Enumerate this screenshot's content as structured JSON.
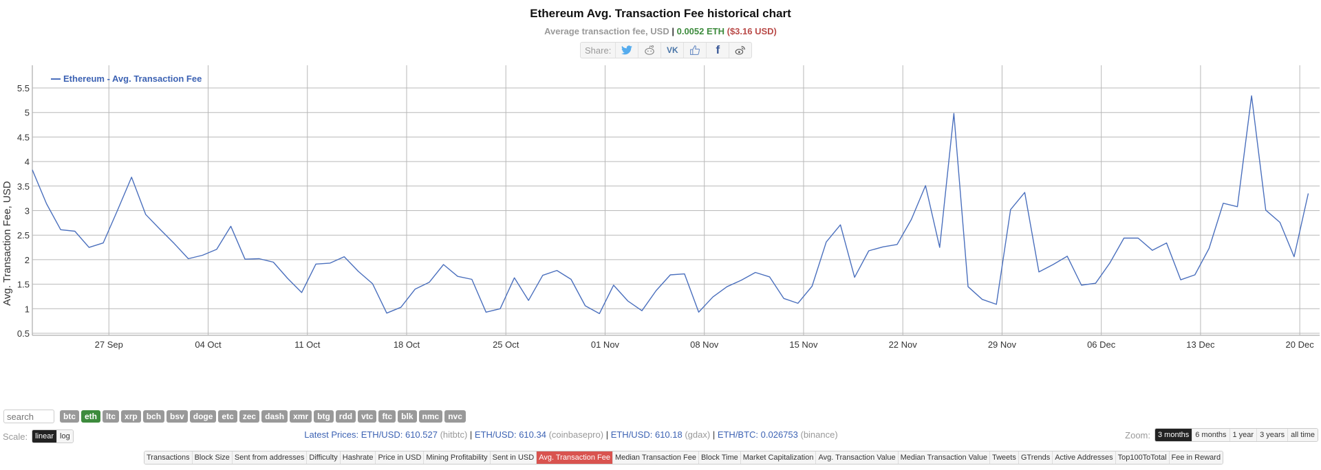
{
  "header": {
    "title": "Ethereum Avg. Transaction Fee historical chart",
    "subtitle_label": "Average transaction fee, USD",
    "subtitle_sep": "|",
    "subtitle_eth": "0.0052 ETH",
    "subtitle_usd": "($3.16 USD)"
  },
  "share": {
    "label": "Share:",
    "icons": [
      {
        "name": "twitter-icon",
        "glyph": "🐦"
      },
      {
        "name": "reddit-icon",
        "glyph": "☺"
      },
      {
        "name": "vk-icon",
        "glyph": "VK"
      },
      {
        "name": "like-icon",
        "glyph": "👍"
      },
      {
        "name": "facebook-icon",
        "glyph": "f"
      },
      {
        "name": "weibo-icon",
        "glyph": "ஃ"
      }
    ]
  },
  "colors": {
    "line": "#4a6fbd",
    "grid": "#b8b8b8",
    "eth_green": "#3d8b3d",
    "usd_red": "#b94a48",
    "active_tab": "#d9534f"
  },
  "search": {
    "placeholder": "search"
  },
  "coins": [
    {
      "label": "btc",
      "active": false
    },
    {
      "label": "eth",
      "active": true
    },
    {
      "label": "ltc",
      "active": false
    },
    {
      "label": "xrp",
      "active": false
    },
    {
      "label": "bch",
      "active": false
    },
    {
      "label": "bsv",
      "active": false
    },
    {
      "label": "doge",
      "active": false
    },
    {
      "label": "etc",
      "active": false
    },
    {
      "label": "zec",
      "active": false
    },
    {
      "label": "dash",
      "active": false
    },
    {
      "label": "xmr",
      "active": false
    },
    {
      "label": "btg",
      "active": false
    },
    {
      "label": "rdd",
      "active": false
    },
    {
      "label": "vtc",
      "active": false
    },
    {
      "label": "ftc",
      "active": false
    },
    {
      "label": "blk",
      "active": false
    },
    {
      "label": "nmc",
      "active": false
    },
    {
      "label": "nvc",
      "active": false
    }
  ],
  "scale": {
    "label": "Scale:",
    "options": [
      {
        "label": "linear",
        "active": true
      },
      {
        "label": "log",
        "active": false
      }
    ]
  },
  "prices": {
    "prefix": "Latest Prices:",
    "items": [
      {
        "pair": "ETH/USD: 610.527",
        "source": "(hitbtc)"
      },
      {
        "pair": "ETH/USD: 610.34",
        "source": "(coinbasepro)"
      },
      {
        "pair": "ETH/USD: 610.18",
        "source": "(gdax)"
      },
      {
        "pair": "ETH/BTC: 0.026753",
        "source": "(binance)"
      }
    ]
  },
  "zoom": {
    "label": "Zoom:",
    "options": [
      {
        "label": "3 months",
        "active": true
      },
      {
        "label": "6 months",
        "active": false
      },
      {
        "label": "1 year",
        "active": false
      },
      {
        "label": "3 years",
        "active": false
      },
      {
        "label": "all time",
        "active": false
      }
    ]
  },
  "tabs": [
    {
      "label": "Transactions",
      "active": false
    },
    {
      "label": "Block Size",
      "active": false
    },
    {
      "label": "Sent from addresses",
      "active": false
    },
    {
      "label": "Difficulty",
      "active": false
    },
    {
      "label": "Hashrate",
      "active": false
    },
    {
      "label": "Price in USD",
      "active": false
    },
    {
      "label": "Mining Profitability",
      "active": false
    },
    {
      "label": "Sent in USD",
      "active": false
    },
    {
      "label": "Avg. Transaction Fee",
      "active": true
    },
    {
      "label": "Median Transaction Fee",
      "active": false
    },
    {
      "label": "Block Time",
      "active": false
    },
    {
      "label": "Market Capitalization",
      "active": false
    },
    {
      "label": "Avg. Transaction Value",
      "active": false
    },
    {
      "label": "Median Transaction Value",
      "active": false
    },
    {
      "label": "Tweets",
      "active": false
    },
    {
      "label": "GTrends",
      "active": false
    },
    {
      "label": "Active Addresses",
      "active": false
    },
    {
      "label": "Top100ToTotal",
      "active": false
    },
    {
      "label": "Fee in Reward",
      "active": false
    }
  ],
  "chart_data": {
    "type": "line",
    "title": "Ethereum Avg. Transaction Fee historical chart",
    "xlabel": "",
    "ylabel": "Avg. Transaction Fee, USD",
    "legend": {
      "label": "Ethereum - Avg. Transaction Fee",
      "position": "top-left"
    },
    "grid": true,
    "ylim": [
      0.5,
      5.8
    ],
    "yticks": [
      0.5,
      1,
      1.5,
      2,
      2.5,
      3,
      3.5,
      4,
      4.5,
      5,
      5.5
    ],
    "x_start_day": -5.4,
    "x_end_day": 85.4,
    "xticks": [
      {
        "label": "27 Sep",
        "day": 0
      },
      {
        "label": "04 Oct",
        "day": 7
      },
      {
        "label": "11 Oct",
        "day": 14
      },
      {
        "label": "18 Oct",
        "day": 21
      },
      {
        "label": "25 Oct",
        "day": 28
      },
      {
        "label": "01 Nov",
        "day": 35
      },
      {
        "label": "08 Nov",
        "day": 42
      },
      {
        "label": "15 Nov",
        "day": 49
      },
      {
        "label": "22 Nov",
        "day": 56
      },
      {
        "label": "29 Nov",
        "day": 63
      },
      {
        "label": "06 Dec",
        "day": 70
      },
      {
        "label": "13 Dec",
        "day": 77
      },
      {
        "label": "20 Dec",
        "day": 84
      }
    ],
    "series": [
      {
        "name": "Ethereum - Avg. Transaction Fee",
        "start_day": -5.4,
        "step_days": 1,
        "values": [
          3.83,
          3.14,
          2.61,
          2.58,
          2.25,
          2.34,
          3.0,
          3.68,
          2.92,
          2.62,
          2.33,
          2.02,
          2.09,
          2.21,
          2.68,
          2.01,
          2.02,
          1.95,
          1.62,
          1.33,
          1.91,
          1.93,
          2.06,
          1.76,
          1.51,
          0.91,
          1.03,
          1.4,
          1.54,
          1.9,
          1.66,
          1.6,
          0.93,
          1.0,
          1.63,
          1.17,
          1.68,
          1.78,
          1.6,
          1.06,
          0.9,
          1.48,
          1.16,
          0.96,
          1.37,
          1.69,
          1.71,
          0.93,
          1.24,
          1.45,
          1.58,
          1.74,
          1.65,
          1.21,
          1.11,
          1.46,
          2.36,
          2.71,
          1.64,
          2.18,
          2.26,
          2.31,
          2.82,
          3.51,
          2.25,
          4.98,
          1.45,
          1.19,
          1.09,
          3.02,
          3.37,
          1.75,
          1.9,
          2.07,
          1.48,
          1.52,
          1.93,
          2.44,
          2.44,
          2.19,
          2.34,
          1.59,
          1.69,
          2.23,
          3.15,
          3.08,
          5.34,
          3.01,
          2.76,
          2.06,
          3.35
        ]
      }
    ]
  }
}
